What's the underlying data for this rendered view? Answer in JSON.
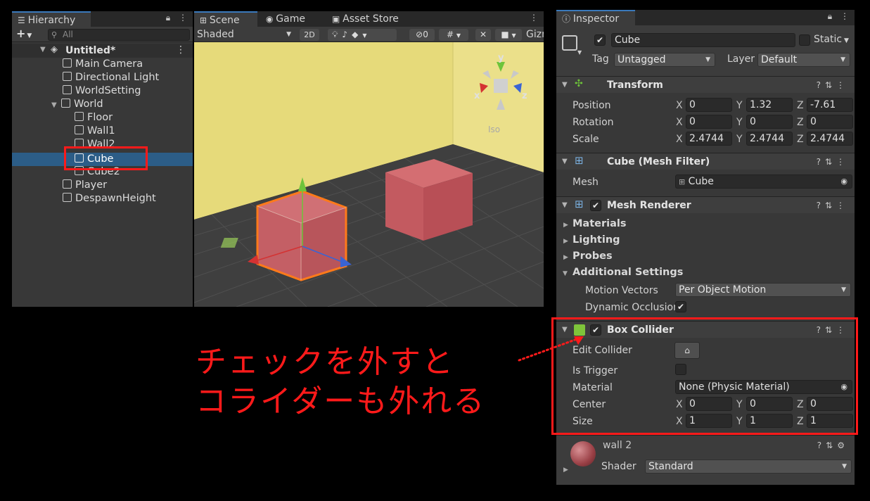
{
  "hierarchy": {
    "tab_label": "Hierarchy",
    "add_label": "+",
    "search_placeholder": "All",
    "scene_name": "Untitled*",
    "items": [
      {
        "label": "Main Camera",
        "depth": 1
      },
      {
        "label": "Directional Light",
        "depth": 1
      },
      {
        "label": "WorldSetting",
        "depth": 1
      },
      {
        "label": "World",
        "depth": 1
      },
      {
        "label": "Floor",
        "depth": 2
      },
      {
        "label": "Wall1",
        "depth": 2
      },
      {
        "label": "Wall2",
        "depth": 2
      },
      {
        "label": "Cube",
        "depth": 2
      },
      {
        "label": "Cube2",
        "depth": 2
      },
      {
        "label": "Player",
        "depth": 1
      },
      {
        "label": "DespawnHeight",
        "depth": 1
      }
    ],
    "selected": "Cube"
  },
  "scene": {
    "tabs": [
      "Scene",
      "Game",
      "Asset Store"
    ],
    "shading_mode": "Shaded",
    "mode_2d": "2D",
    "hidden_count": "0",
    "gizmos_label": "Gizm",
    "iso_label": "Iso",
    "axis_y": "y",
    "axis_x": "x",
    "axis_z": "z"
  },
  "inspector": {
    "tab_label": "Inspector",
    "object_name": "Cube",
    "static_label": "Static",
    "tag_label": "Tag",
    "tag_value": "Untagged",
    "layer_label": "Layer",
    "layer_value": "Default",
    "transform": {
      "title": "Transform",
      "position_label": "Position",
      "rotation_label": "Rotation",
      "scale_label": "Scale",
      "position": {
        "x": "0",
        "y": "1.32",
        "z": "-7.61"
      },
      "rotation": {
        "x": "0",
        "y": "0",
        "z": "0"
      },
      "scale": {
        "x": "2.4744",
        "y": "2.4744",
        "z": "2.4744"
      }
    },
    "mesh_filter": {
      "title": "Cube (Mesh Filter)",
      "mesh_label": "Mesh",
      "mesh_value": "Cube"
    },
    "mesh_renderer": {
      "title": "Mesh Renderer",
      "materials_label": "Materials",
      "lighting_label": "Lighting",
      "probes_label": "Probes",
      "additional_label": "Additional Settings",
      "motion_vectors_label": "Motion Vectors",
      "motion_vectors_value": "Per Object Motion",
      "dynamic_occlusion_label": "Dynamic Occlusion"
    },
    "box_collider": {
      "title": "Box Collider",
      "edit_collider_label": "Edit Collider",
      "is_trigger_label": "Is Trigger",
      "material_label": "Material",
      "material_value": "None (Physic Material)",
      "center_label": "Center",
      "size_label": "Size",
      "center": {
        "x": "0",
        "y": "0",
        "z": "0"
      },
      "size": {
        "x": "1",
        "y": "1",
        "z": "1"
      }
    },
    "material": {
      "name": "wall 2",
      "shader_label": "Shader",
      "shader_value": "Standard"
    },
    "axis_x": "X",
    "axis_y": "Y",
    "axis_z": "Z"
  },
  "annotation": {
    "line1": "チェックを外すと",
    "line2": "コライダーも外れる"
  },
  "colors": {
    "annotation_red": "#ff1a1a",
    "selection_blue": "#2c5d87",
    "wall_yellow": "#e8dc7c",
    "cube_red": "#c8595f"
  }
}
